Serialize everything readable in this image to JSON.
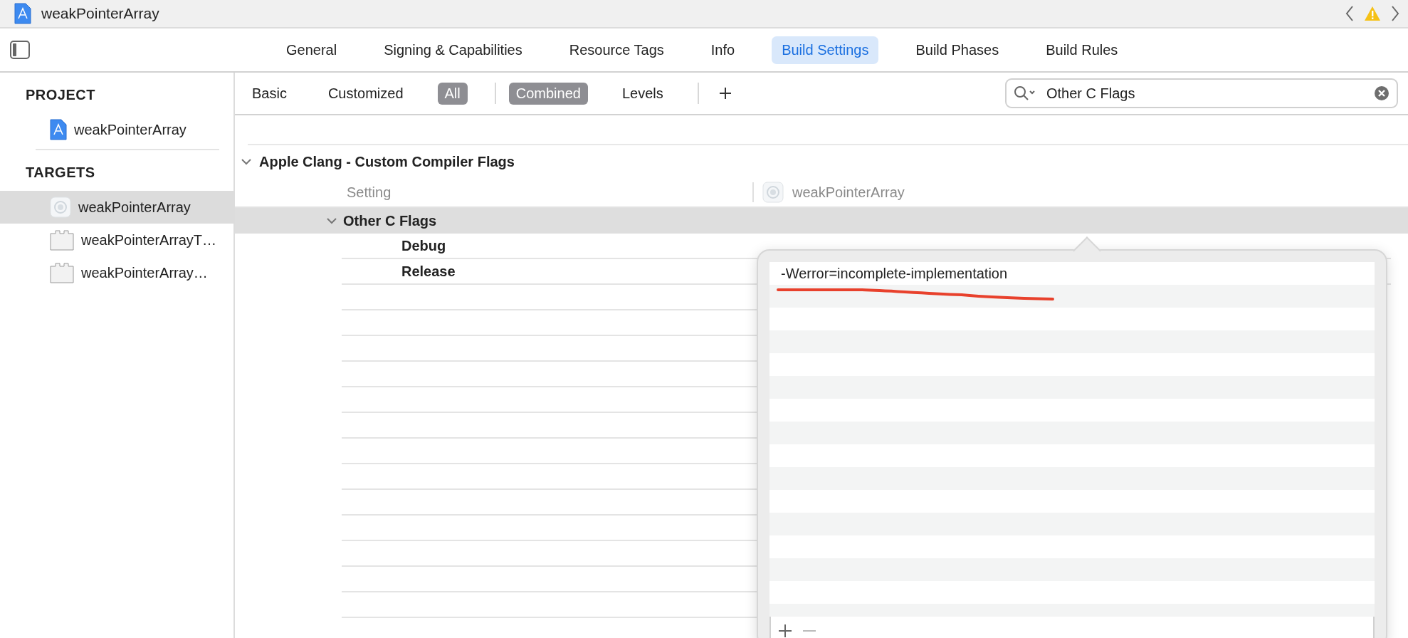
{
  "window": {
    "title": "weakPointerArray"
  },
  "editor_tabs": [
    {
      "label": "General",
      "selected": false
    },
    {
      "label": "Signing & Capabilities",
      "selected": false
    },
    {
      "label": "Resource Tags",
      "selected": false
    },
    {
      "label": "Info",
      "selected": false
    },
    {
      "label": "Build Settings",
      "selected": true
    },
    {
      "label": "Build Phases",
      "selected": false
    },
    {
      "label": "Build Rules",
      "selected": false
    }
  ],
  "sidebar": {
    "sections": [
      {
        "heading": "PROJECT",
        "items": [
          {
            "label": "weakPointerArray",
            "kind": "project",
            "selected": false
          }
        ]
      },
      {
        "heading": "TARGETS",
        "items": [
          {
            "label": "weakPointerArray",
            "kind": "app",
            "selected": true
          },
          {
            "label": "weakPointerArrayT…",
            "kind": "bundle",
            "selected": false
          },
          {
            "label": "weakPointerArray…",
            "kind": "bundle",
            "selected": false
          }
        ]
      }
    ]
  },
  "filter_bar": {
    "scope": [
      {
        "label": "Basic",
        "selected": false
      },
      {
        "label": "Customized",
        "selected": false
      },
      {
        "label": "All",
        "selected": true
      }
    ],
    "view": [
      {
        "label": "Combined",
        "selected": true
      },
      {
        "label": "Levels",
        "selected": false
      }
    ],
    "search": {
      "value": "Other C Flags"
    }
  },
  "settings": {
    "section": {
      "title": "Apple Clang - Custom Compiler Flags",
      "expanded": true
    },
    "columns": {
      "setting": "Setting",
      "target": "weakPointerArray"
    },
    "setting": {
      "name": "Other C Flags",
      "expanded": true,
      "selected": true,
      "configurations": [
        {
          "name": "Debug"
        },
        {
          "name": "Release"
        }
      ]
    }
  },
  "popover": {
    "values": [
      "-Werror=incomplete-implementation"
    ]
  }
}
